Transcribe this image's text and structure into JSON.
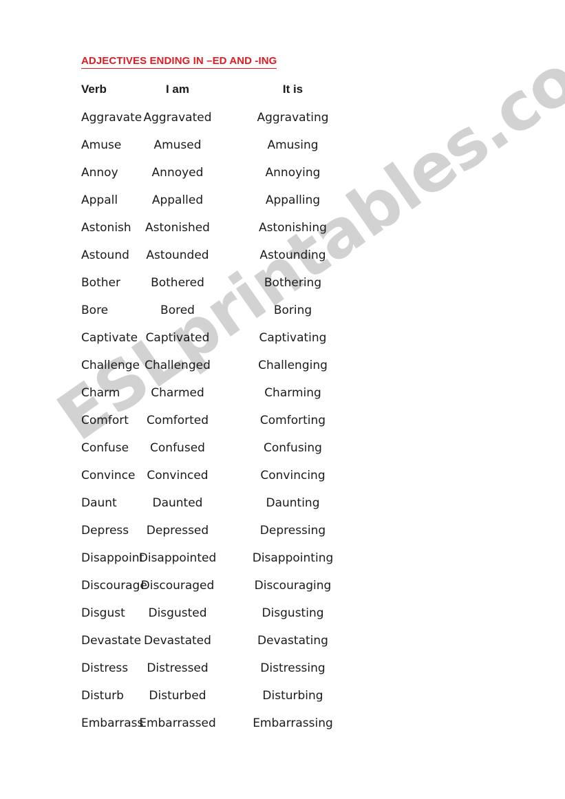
{
  "document": {
    "title": "ADJECTIVES ENDING IN –ED AND -ING",
    "title_color": "#e01b22",
    "background_color": "#ffffff",
    "body_text_color": "#1a1a1a"
  },
  "watermark": {
    "text": "ESLprintables.com",
    "color": "#d2d2d2",
    "rotation_degrees": -35
  },
  "table": {
    "headers": {
      "verb": "Verb",
      "i_am": "I am",
      "it_is": "It is"
    },
    "rows": [
      {
        "verb": "Aggravate",
        "i_am": "Aggravated",
        "it_is": "Aggravating"
      },
      {
        "verb": "Amuse",
        "i_am": "Amused",
        "it_is": "Amusing"
      },
      {
        "verb": "Annoy",
        "i_am": "Annoyed",
        "it_is": "Annoying"
      },
      {
        "verb": "Appall",
        "i_am": "Appalled",
        "it_is": "Appalling"
      },
      {
        "verb": "Astonish",
        "i_am": "Astonished",
        "it_is": "Astonishing"
      },
      {
        "verb": "Astound",
        "i_am": "Astounded",
        "it_is": "Astounding"
      },
      {
        "verb": "Bother",
        "i_am": "Bothered",
        "it_is": "Bothering"
      },
      {
        "verb": "Bore",
        "i_am": "Bored",
        "it_is": "Boring"
      },
      {
        "verb": "Captivate",
        "i_am": "Captivated",
        "it_is": "Captivating"
      },
      {
        "verb": "Challenge",
        "i_am": "Challenged",
        "it_is": "Challenging"
      },
      {
        "verb": "Charm",
        "i_am": "Charmed",
        "it_is": "Charming"
      },
      {
        "verb": "Comfort",
        "i_am": "Comforted",
        "it_is": "Comforting"
      },
      {
        "verb": "Confuse",
        "i_am": "Confused",
        "it_is": "Confusing"
      },
      {
        "verb": "Convince",
        "i_am": "Convinced",
        "it_is": "Convincing"
      },
      {
        "verb": "Daunt",
        "i_am": "Daunted",
        "it_is": "Daunting"
      },
      {
        "verb": "Depress",
        "i_am": "Depressed",
        "it_is": "Depressing"
      },
      {
        "verb": "Disappoint",
        "i_am": "Disappointed",
        "it_is": "Disappointing"
      },
      {
        "verb": "Discourage",
        "i_am": "Discouraged",
        "it_is": "Discouraging"
      },
      {
        "verb": "Disgust",
        "i_am": "Disgusted",
        "it_is": "Disgusting"
      },
      {
        "verb": "Devastate",
        "i_am": "Devastated",
        "it_is": "Devastating"
      },
      {
        "verb": "Distress",
        "i_am": "Distressed",
        "it_is": "Distressing"
      },
      {
        "verb": "Disturb",
        "i_am": "Disturbed",
        "it_is": "Disturbing"
      },
      {
        "verb": "Embarrass",
        "i_am": "Embarrassed",
        "it_is": "Embarrassing"
      }
    ]
  }
}
